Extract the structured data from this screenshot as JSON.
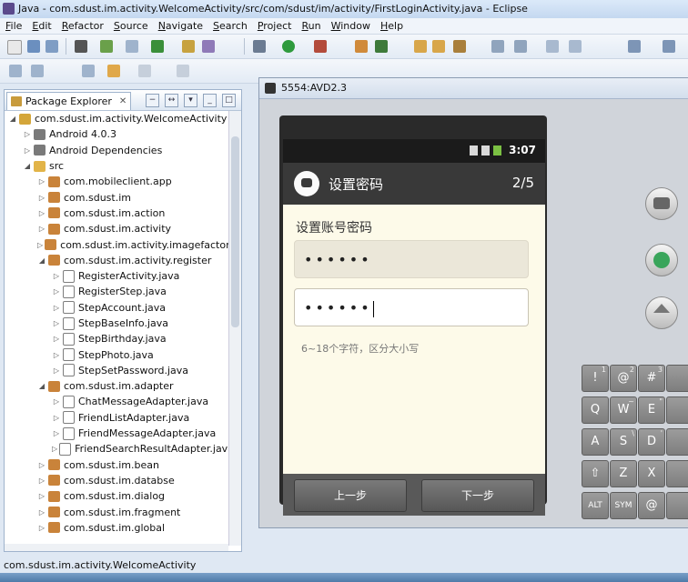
{
  "window": {
    "title": "Java - com.sdust.im.activity.WelcomeActivity/src/com/sdust/im/activity/FirstLoginActivity.java - Eclipse"
  },
  "menu": [
    "File",
    "Edit",
    "Refactor",
    "Source",
    "Navigate",
    "Search",
    "Project",
    "Run",
    "Window",
    "Help"
  ],
  "explorer": {
    "tab_label": "Package Explorer",
    "tab_close": "✕",
    "items": [
      {
        "label": "com.sdust.im.activity.WelcomeActivity",
        "icon": "project-icon",
        "twisty": "◢"
      },
      {
        "label": "Android 4.0.3",
        "icon": "library-icon",
        "twisty": "▷"
      },
      {
        "label": "Android Dependencies",
        "icon": "library-icon",
        "twisty": "▷"
      },
      {
        "label": "src",
        "icon": "folder-icon",
        "twisty": "◢"
      },
      {
        "label": "com.mobileclient.app",
        "icon": "package-icon",
        "twisty": "▷"
      },
      {
        "label": "com.sdust.im",
        "icon": "package-icon",
        "twisty": "▷"
      },
      {
        "label": "com.sdust.im.action",
        "icon": "package-icon",
        "twisty": "▷"
      },
      {
        "label": "com.sdust.im.activity",
        "icon": "package-icon",
        "twisty": "▷"
      },
      {
        "label": "com.sdust.im.activity.imagefactor",
        "icon": "package-icon",
        "twisty": "▷"
      },
      {
        "label": "com.sdust.im.activity.register",
        "icon": "package-icon",
        "twisty": "◢"
      },
      {
        "label": "RegisterActivity.java",
        "icon": "java-file-icon",
        "twisty": "▷"
      },
      {
        "label": "RegisterStep.java",
        "icon": "java-file-icon",
        "twisty": "▷"
      },
      {
        "label": "StepAccount.java",
        "icon": "java-file-icon",
        "twisty": "▷"
      },
      {
        "label": "StepBaseInfo.java",
        "icon": "java-file-icon",
        "twisty": "▷"
      },
      {
        "label": "StepBirthday.java",
        "icon": "java-file-icon",
        "twisty": "▷"
      },
      {
        "label": "StepPhoto.java",
        "icon": "java-file-icon",
        "twisty": "▷"
      },
      {
        "label": "StepSetPassword.java",
        "icon": "java-file-icon",
        "twisty": "▷"
      },
      {
        "label": "com.sdust.im.adapter",
        "icon": "package-icon",
        "twisty": "◢"
      },
      {
        "label": "ChatMessageAdapter.java",
        "icon": "java-file-icon",
        "twisty": "▷"
      },
      {
        "label": "FriendListAdapter.java",
        "icon": "java-file-icon",
        "twisty": "▷"
      },
      {
        "label": "FriendMessageAdapter.java",
        "icon": "java-file-icon",
        "twisty": "▷"
      },
      {
        "label": "FriendSearchResultAdapter.java",
        "icon": "java-file-icon",
        "twisty": "▷"
      },
      {
        "label": "com.sdust.im.bean",
        "icon": "package-icon",
        "twisty": "▷"
      },
      {
        "label": "com.sdust.im.databse",
        "icon": "package-icon",
        "twisty": "▷"
      },
      {
        "label": "com.sdust.im.dialog",
        "icon": "package-icon",
        "twisty": "▷"
      },
      {
        "label": "com.sdust.im.fragment",
        "icon": "package-icon",
        "twisty": "▷"
      },
      {
        "label": "com.sdust.im.global",
        "icon": "package-icon",
        "twisty": "▷"
      }
    ]
  },
  "emulator": {
    "title": "5554:AVD2.3",
    "status_time": "3:07",
    "app_title": "设置密码",
    "step": "2/5",
    "heading": "设置账号密码",
    "password_1": "••••••",
    "password_2": "••••••",
    "hint": "6~18个字符，区分大小写",
    "prev_button": "上一步",
    "next_button": "下一步"
  },
  "keyboard": [
    {
      "main": "!",
      "alt": "1"
    },
    {
      "main": "@",
      "alt": "2"
    },
    {
      "main": "#",
      "alt": "3"
    },
    {
      "main": "",
      "alt": ""
    },
    {
      "main": "Q",
      "alt": ""
    },
    {
      "main": "W",
      "alt": "~"
    },
    {
      "main": "E",
      "alt": "\""
    },
    {
      "main": "",
      "alt": ""
    },
    {
      "main": "A",
      "alt": ""
    },
    {
      "main": "S",
      "alt": "\\"
    },
    {
      "main": "D",
      "alt": "'"
    },
    {
      "main": "",
      "alt": ""
    },
    {
      "main": "⇧",
      "alt": ""
    },
    {
      "main": "Z",
      "alt": ""
    },
    {
      "main": "X",
      "alt": ""
    },
    {
      "main": "",
      "alt": ""
    },
    {
      "main": "ALT",
      "alt": ""
    },
    {
      "main": "SYM",
      "alt": ""
    },
    {
      "main": "@",
      "alt": ""
    },
    {
      "main": "",
      "alt": ""
    }
  ],
  "statusbar": {
    "text": "com.sdust.im.activity.WelcomeActivity"
  },
  "colors": {
    "app_bar": "#393939",
    "content_bg": "#fdfae9",
    "bottom_bar": "#595959"
  }
}
